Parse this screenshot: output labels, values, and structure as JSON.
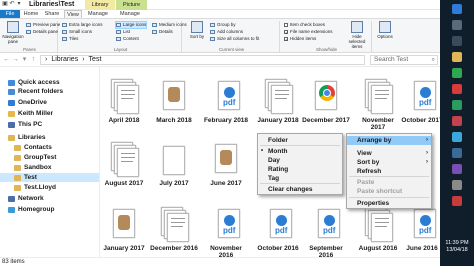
{
  "window": {
    "title": "Libraries\\Test",
    "context_tabs": [
      "Library Tools",
      "Picture Tools"
    ],
    "controls": [
      "–",
      "□",
      "✕"
    ]
  },
  "tabs": [
    "File",
    "Home",
    "Share",
    "View",
    "Manage",
    "Manage"
  ],
  "ribbon": {
    "panes": {
      "label": "Panes",
      "navigation_pane": "Navigation pane",
      "preview_pane": "Preview pane",
      "details_pane": "Details pane"
    },
    "layout": {
      "label": "Layout",
      "items": [
        "Extra large icons",
        "Large icons",
        "Medium icons",
        "Small icons",
        "List",
        "Details",
        "Tiles",
        "Content"
      ],
      "selected": "Large icons"
    },
    "current_view": {
      "label": "Current view",
      "sort_by": "Sort by",
      "group_by": "Group by",
      "add_columns": "Add columns",
      "size_all_columns": "Size all columns to fit"
    },
    "show_hide": {
      "label": "Show/hide",
      "item_check_boxes": "Item check boxes",
      "file_name_extensions": "File name extensions",
      "hidden_items": "Hidden items",
      "hide_selected": "Hide selected items"
    },
    "options": {
      "label": "Options"
    }
  },
  "address": {
    "crumbs": [
      "Libraries",
      "Test"
    ],
    "search_placeholder": "Search Test"
  },
  "nav": {
    "items": [
      {
        "label": "Quick access",
        "color": "#3e8ce0"
      },
      {
        "label": "Recent folders",
        "color": "#4b8bd4"
      },
      {
        "label": "OneDrive",
        "color": "#2f7bd8"
      },
      {
        "label": "Keith Miller",
        "color": "#e6b84a"
      },
      {
        "label": "This PC",
        "color": "#4b6ea8"
      },
      {
        "label": "Libraries",
        "color": "#e0b556"
      },
      {
        "label": "Contacts",
        "color": "#e0b556"
      },
      {
        "label": "GroupTest",
        "color": "#e0b556"
      },
      {
        "label": "Sandbox",
        "color": "#e0b556"
      },
      {
        "label": "Test",
        "color": "#e0b556"
      },
      {
        "label": "Test.Lloyd",
        "color": "#e0b556"
      },
      {
        "label": "Network",
        "color": "#4b6ea8"
      },
      {
        "label": "Homegroup",
        "color": "#3b9ad9"
      }
    ],
    "selected": "Test"
  },
  "tiles": [
    {
      "label": "April 2018",
      "kind": "stack"
    },
    {
      "label": "March 2018",
      "kind": "image"
    },
    {
      "label": "February 2018",
      "kind": "pdf"
    },
    {
      "label": "January 2018",
      "kind": "stack"
    },
    {
      "label": "December 2017",
      "kind": "chrome"
    },
    {
      "label": "November 2017",
      "kind": "stack"
    },
    {
      "label": "October 2017",
      "kind": "pdf"
    },
    {
      "label": "August 2017",
      "kind": "stack"
    },
    {
      "label": "July 2017",
      "kind": "blank"
    },
    {
      "label": "June 2017",
      "kind": "image"
    },
    {
      "label": "January 2017",
      "kind": "image"
    },
    {
      "label": "December 2016",
      "kind": "stack"
    },
    {
      "label": "November 2016",
      "kind": "pdf"
    },
    {
      "label": "October 2016",
      "kind": "pdf"
    },
    {
      "label": "September 2016",
      "kind": "pdf"
    },
    {
      "label": "August 2016",
      "kind": "stack"
    },
    {
      "label": "June 2016",
      "kind": "pdf"
    }
  ],
  "submenu": {
    "items": [
      "Folder",
      "Month",
      "Day",
      "Rating",
      "Tag",
      "Clear changes"
    ],
    "checked": "Month"
  },
  "context_menu": {
    "items": [
      "Arrange by",
      "View",
      "Sort by",
      "Refresh",
      "Paste",
      "Paste shortcut",
      "Properties"
    ],
    "highlighted": "Arrange by"
  },
  "status": {
    "count": "83 items"
  },
  "taskbar": {
    "time": "11:39 PM",
    "date": "13/04/18"
  }
}
